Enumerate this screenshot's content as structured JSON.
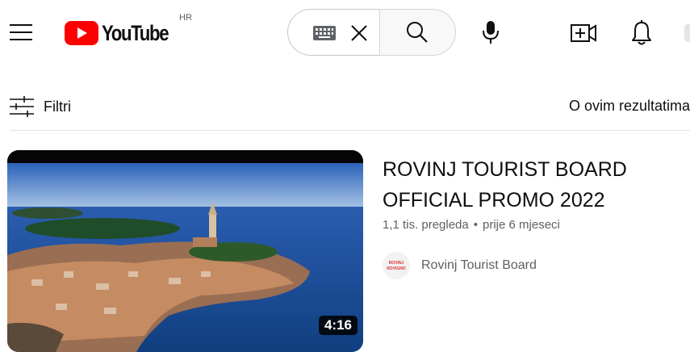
{
  "header": {
    "logo_text": "YouTube",
    "region_code": "HR",
    "icons": {
      "menu": "hamburger-menu-icon",
      "keyboard": "keyboard-icon",
      "clear": "close-icon",
      "search": "search-icon",
      "mic": "microphone-icon",
      "create": "create-video-icon",
      "notifications": "bell-icon"
    },
    "brand_color": "#ff0000"
  },
  "filter_bar": {
    "filters_label": "Filtri",
    "about_results_label": "O ovim rezultatima",
    "icon": "filter-sliders-icon"
  },
  "result": {
    "title": "ROVINJ TOURIST BOARD OFFICIAL PROMO 2022",
    "views": "1,1 tis. pregleda",
    "separator": "•",
    "age": "prije 6 mjeseci",
    "duration": "4:16",
    "channel_name": "Rovinj Tourist Board",
    "channel_avatar_text_line1": "ROVINJ",
    "channel_avatar_text_line2": "ROVIGNO"
  }
}
